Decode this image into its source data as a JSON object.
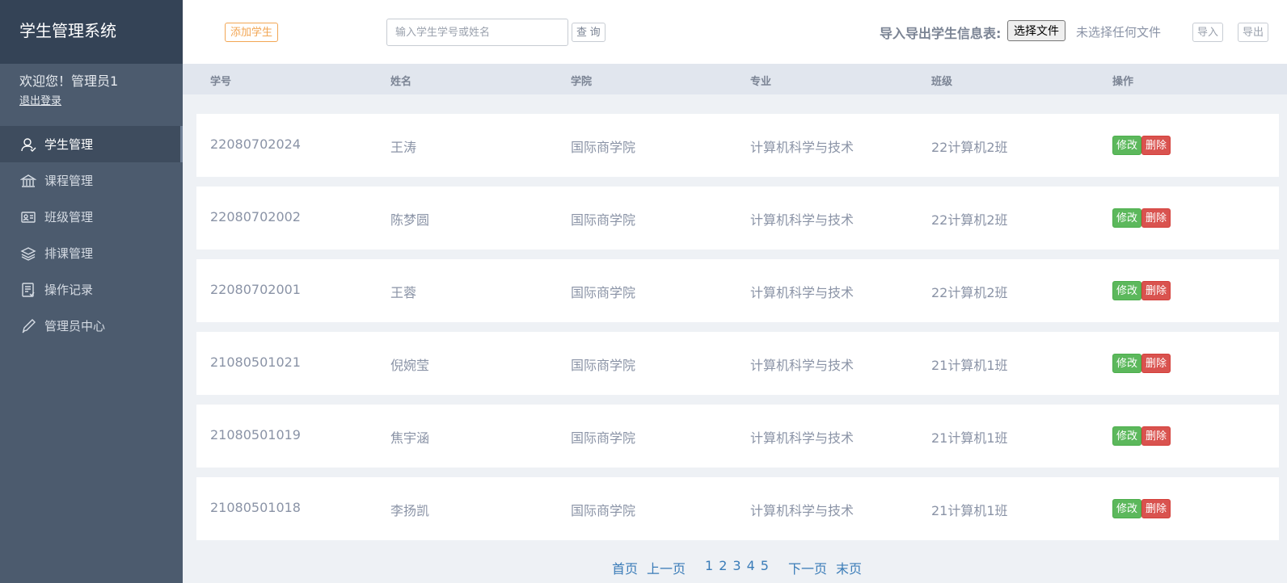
{
  "sidebar": {
    "brand": "学生管理系统",
    "welcome": "欢迎您！管理员1",
    "logout": "退出登录",
    "items": [
      {
        "label": "学生管理",
        "icon": "user-icon"
      },
      {
        "label": "课程管理",
        "icon": "building-icon"
      },
      {
        "label": "班级管理",
        "icon": "id-card-icon"
      },
      {
        "label": "排课管理",
        "icon": "layers-icon"
      },
      {
        "label": "操作记录",
        "icon": "log-icon"
      },
      {
        "label": "管理员中心",
        "icon": "pen-icon"
      }
    ],
    "active_index": 0
  },
  "toolbar": {
    "add_label": "添加学生",
    "search_placeholder": "输入学生学号或姓名",
    "query_label": "查 询",
    "io_label": "导入导出学生信息表:",
    "file_button": "选择文件",
    "file_status": "未选择任何文件",
    "import_label": "导入",
    "export_label": "导出"
  },
  "table": {
    "headers": [
      "学号",
      "姓名",
      "学院",
      "专业",
      "班级",
      "操作"
    ],
    "rows": [
      {
        "id": "22080702024",
        "name": "王涛",
        "college": "国际商学院",
        "major": "计算机科学与技术",
        "class": "22计算机2班"
      },
      {
        "id": "22080702002",
        "name": "陈梦圆",
        "college": "国际商学院",
        "major": "计算机科学与技术",
        "class": "22计算机2班"
      },
      {
        "id": "22080702001",
        "name": "王蓉",
        "college": "国际商学院",
        "major": "计算机科学与技术",
        "class": "22计算机2班"
      },
      {
        "id": "21080501021",
        "name": "倪婉莹",
        "college": "国际商学院",
        "major": "计算机科学与技术",
        "class": "21计算机1班"
      },
      {
        "id": "21080501019",
        "name": "焦宇涵",
        "college": "国际商学院",
        "major": "计算机科学与技术",
        "class": "21计算机1班"
      },
      {
        "id": "21080501018",
        "name": "李扬凯",
        "college": "国际商学院",
        "major": "计算机科学与技术",
        "class": "21计算机1班"
      }
    ],
    "edit_label": "修改",
    "delete_label": "删除"
  },
  "pager": {
    "first": "首页",
    "prev": "上一页",
    "pages": [
      "1",
      "2",
      "3",
      "4",
      "5"
    ],
    "next": "下一页",
    "last": "末页"
  },
  "colors": {
    "sidebar_bg": "#4c5b6e",
    "brand_bg": "#344356",
    "accent_orange": "#f2a654",
    "edit_green": "#5cb85c",
    "delete_red": "#d9534f",
    "link_blue": "#3a7cb8"
  }
}
